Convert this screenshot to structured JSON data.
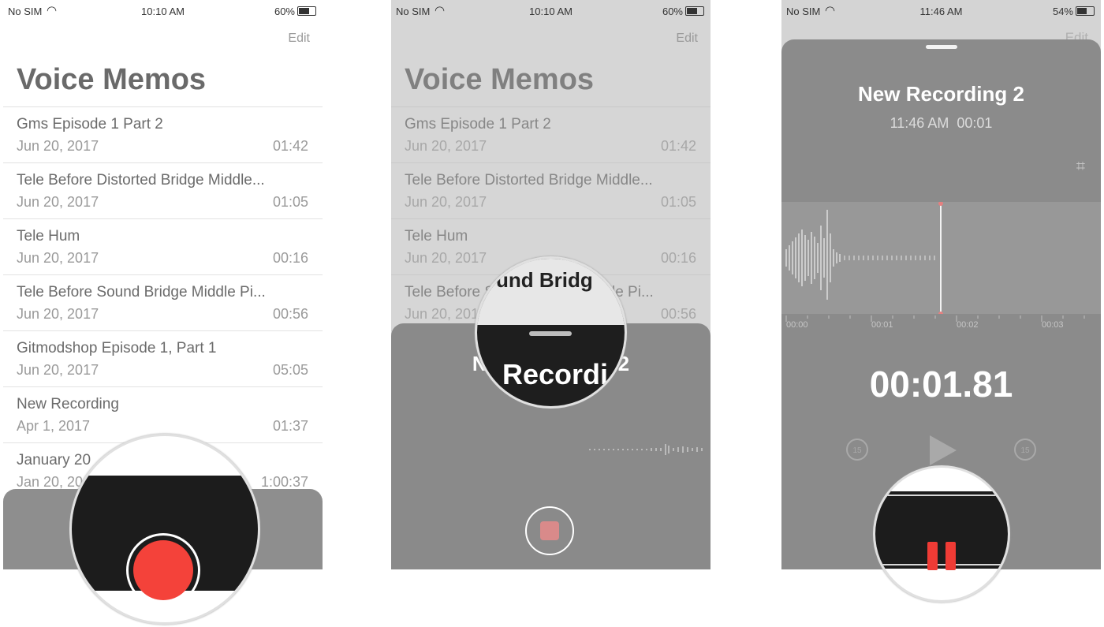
{
  "status_left": {
    "carrier": "No SIM",
    "time": "10:10 AM",
    "battery": "60%"
  },
  "status_right": {
    "carrier": "No SIM",
    "time": "11:46 AM",
    "battery": "54%"
  },
  "header": {
    "edit": "Edit",
    "title": "Voice Memos"
  },
  "recordings": [
    {
      "name": "Gms Episode 1 Part 2",
      "date": "Jun 20, 2017",
      "duration": "01:42"
    },
    {
      "name": "Tele Before Distorted Bridge Middle...",
      "date": "Jun 20, 2017",
      "duration": "01:05"
    },
    {
      "name": "Tele Hum",
      "date": "Jun 20, 2017",
      "duration": "00:16"
    },
    {
      "name": "Tele Before Sound Bridge Middle Pi...",
      "date": "Jun 20, 2017",
      "duration": "00:56"
    },
    {
      "name": "Gitmodshop Episode 1, Part 1",
      "date": "Jun 20, 2017",
      "duration": "05:05"
    },
    {
      "name": "New Recording",
      "date": "Apr 1, 2017",
      "duration": "01:37"
    },
    {
      "name": "January 20",
      "date": "Jan 20, 20",
      "duration": "1:00:37"
    }
  ],
  "recording_sheet": {
    "title": "New Recording 2",
    "start_time": "11:46 AM",
    "elapsed": "00:01",
    "timer": "00:01.81",
    "timeline_ticks": [
      "00:00",
      "00:01",
      "00:02",
      "00:03"
    ],
    "skip_back": "15",
    "skip_forward": "15"
  },
  "magnifier_2": {
    "top_text": "und Bridg",
    "big_text": "Recordi 2"
  },
  "sheet2_partial_title": "No",
  "sheet2_partial_suffix": "2",
  "icons": {
    "record": "record-icon",
    "stop": "stop-icon",
    "pause": "pause-icon",
    "play": "play-icon",
    "wifi": "wifi-icon",
    "crop": "crop-icon"
  },
  "colors": {
    "record_red": "#f4423a",
    "pause_red": "#ef3b35"
  }
}
